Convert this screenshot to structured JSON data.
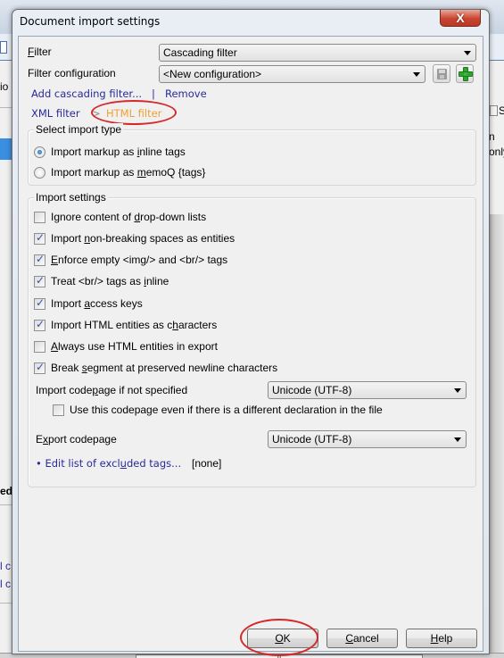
{
  "background_app": {
    "left_texts": [
      "io",
      "ed i",
      "l c",
      "l c"
    ],
    "right_texts": [
      "S",
      "n",
      "only"
    ]
  },
  "dialog": {
    "title": "Document import settings",
    "close_glyph": "X",
    "filter": {
      "label_prefix": "",
      "label_underlined": "F",
      "label_rest": "ilter",
      "value": "Cascading filter"
    },
    "filter_configuration": {
      "label": "Filter configuration",
      "value": "<New configuration>"
    },
    "links": {
      "add_cascading": "Add cascading filter...",
      "separator": "|",
      "remove": "Remove"
    },
    "breadcrumb": {
      "items": [
        "XML filter",
        "HTML filter"
      ],
      "separator": ">",
      "active_index": 1
    },
    "import_type": {
      "title": "Select import type",
      "options": [
        {
          "pre": "Import markup as ",
          "u": "i",
          "post": "nline tags",
          "selected": true
        },
        {
          "pre": "Import markup as ",
          "u": "m",
          "post": "emoQ {tags}",
          "selected": false
        }
      ]
    },
    "import_settings": {
      "title": "Import settings",
      "checkboxes": [
        {
          "pre": "Ignore content of ",
          "u": "d",
          "post": "rop-down lists",
          "checked": false
        },
        {
          "pre": "Import ",
          "u": "n",
          "post": "on-breaking spaces as entities",
          "checked": true
        },
        {
          "pre": "",
          "u": "E",
          "post": "nforce empty <img/> and <br/> tags",
          "checked": true
        },
        {
          "pre": "Treat <br/> tags as ",
          "u": "i",
          "post": "nline",
          "checked": true
        },
        {
          "pre": "Import ",
          "u": "a",
          "post": "ccess keys",
          "checked": true
        },
        {
          "pre": "Import HTML entities as c",
          "u": "h",
          "post": "aracters",
          "checked": true
        },
        {
          "pre": "",
          "u": "A",
          "post": "lways use HTML entities in export",
          "checked": false
        },
        {
          "pre": "Break ",
          "u": "s",
          "post": "egment at preserved newline characters",
          "checked": true
        }
      ],
      "import_codepage": {
        "pre": "Import code",
        "u": "p",
        "post": "age if not specified",
        "value": "Unicode (UTF-8)"
      },
      "use_codepage_checkbox": {
        "label": "Use this codepage even if there is a different declaration in the file",
        "checked": false
      },
      "export_codepage": {
        "pre": "E",
        "u": "x",
        "post": "port codepage",
        "value": "Unicode (UTF-8)"
      },
      "excluded_tags": {
        "bullet": "•",
        "pre": "Edit list of excl",
        "u": "u",
        "post": "ded tags...",
        "value": "[none]"
      }
    },
    "buttons": {
      "ok": {
        "u": "O",
        "post": "K"
      },
      "cancel": {
        "u": "C",
        "post": "ancel"
      },
      "help": {
        "u": "H",
        "post": "elp"
      }
    }
  },
  "colors": {
    "link": "#2a2a9a",
    "active_link": "#f0a030",
    "annotation": "#d42a2a",
    "close_button": "#c9442f"
  }
}
